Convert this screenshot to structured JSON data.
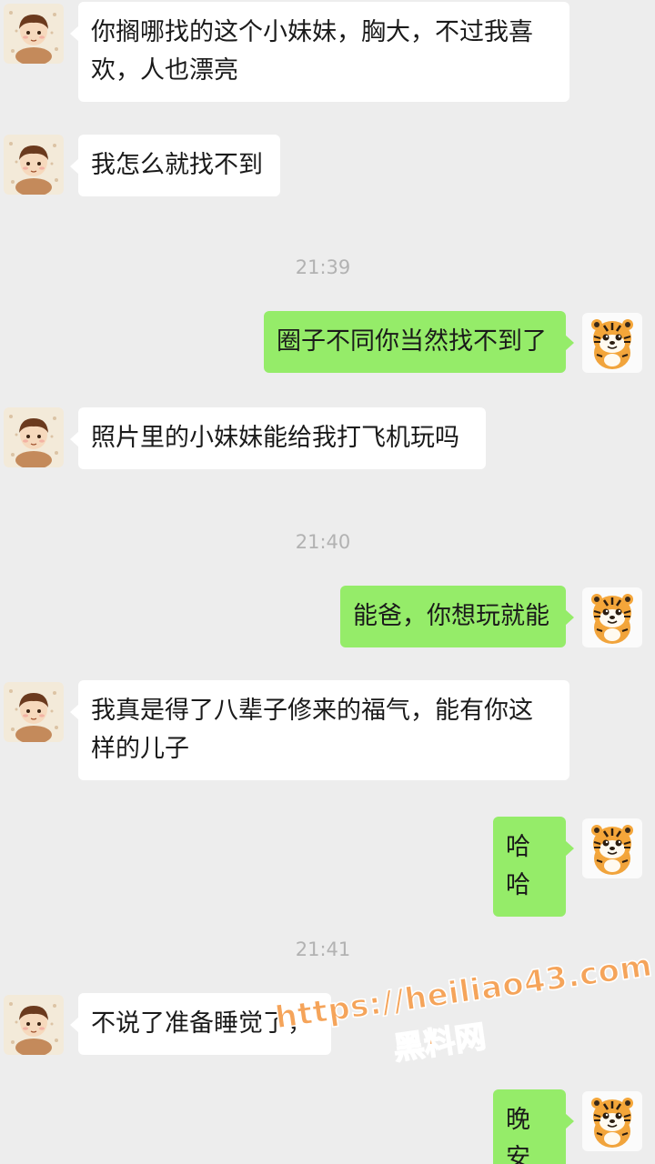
{
  "colors": {
    "background": "#ededed",
    "incoming_bubble": "#ffffff",
    "outgoing_bubble": "#95ec69",
    "timestamp": "#b2b2b2",
    "watermark": "#f5a45a"
  },
  "icons": {
    "friend_avatar": "boy-cartoon-avatar-icon",
    "self_avatar": "tiger-cartoon-avatar-icon"
  },
  "messages": [
    {
      "side": "in",
      "text": "你搁哪找的这个小妹妹，胸大，不过我喜欢，人也漂亮"
    },
    {
      "side": "in",
      "text": "我怎么就找不到"
    },
    {
      "time": "21:39"
    },
    {
      "side": "out",
      "text": "圈子不同你当然找不到了"
    },
    {
      "side": "in",
      "text": "照片里的小妹妹能给我打飞机玩吗"
    },
    {
      "time": "21:40"
    },
    {
      "side": "out",
      "text": "能爸，你想玩就能"
    },
    {
      "side": "in",
      "text": "我真是得了八辈子修来的福气，能有你这样的儿子"
    },
    {
      "side": "out",
      "text": "哈哈"
    },
    {
      "time": "21:41"
    },
    {
      "side": "in",
      "text": "不说了准备睡觉了，"
    },
    {
      "side": "out",
      "text": "晚安"
    }
  ],
  "watermark": {
    "url": "https://heiliao43.com",
    "name": "黑料网"
  }
}
